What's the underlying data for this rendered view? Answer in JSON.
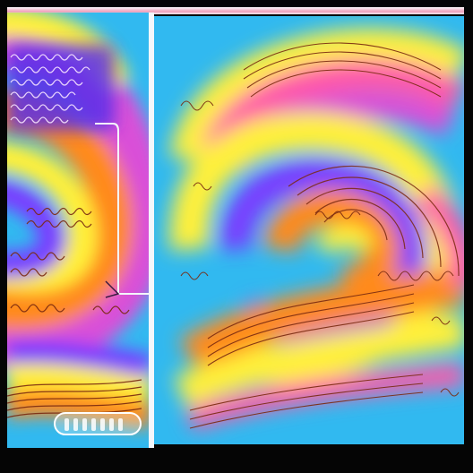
{
  "colors": {
    "background": "#31b9f0",
    "frame": "#050505",
    "orange": "#ff8a1e",
    "yellow": "#fff03a",
    "magenta": "#d94fd8",
    "violet": "#7a3cff",
    "pink": "#ff5aa8",
    "ink": "#7a2a10"
  },
  "icons": {
    "control": "pill-slider-icon"
  }
}
